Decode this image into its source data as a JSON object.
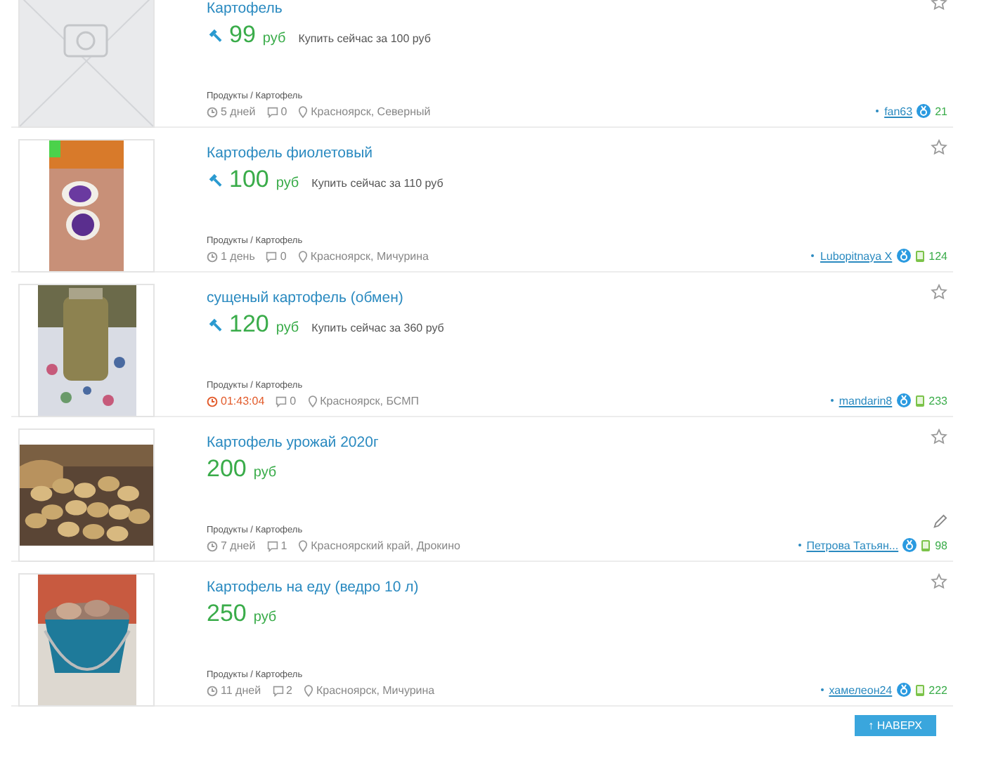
{
  "listings": [
    {
      "title": "Картофель",
      "image": {
        "kind": "placeholder"
      },
      "auction": true,
      "price": "99",
      "currency": "руб",
      "buy_now": "Купить сейчас за 100 руб",
      "category": "Продукты / Картофель",
      "age": "5 дней",
      "urgent": false,
      "comments": "0",
      "location": "Красноярск, Северный",
      "seller": "fan63",
      "verified": true,
      "phone": false,
      "rating": "21",
      "favorite": false,
      "pencil": false
    },
    {
      "title": "Картофель фиолетовый",
      "auction": true,
      "price": "100",
      "currency": "руб",
      "buy_now": "Купить сейчас за 110 руб",
      "category": "Продукты / Картофель",
      "age": "1 день",
      "urgent": false,
      "comments": "0",
      "location": "Красноярск, Мичурина",
      "seller": "Lubopitnaya X",
      "verified": true,
      "phone": true,
      "rating": "124",
      "favorite": false,
      "pencil": false
    },
    {
      "title": "сущеный картофель (обмен)",
      "auction": true,
      "price": "120",
      "currency": "руб",
      "buy_now": "Купить сейчас за 360 руб",
      "category": "Продукты / Картофель",
      "age": "01:43:04",
      "urgent": true,
      "comments": "0",
      "location": "Красноярск, БСМП",
      "seller": "mandarin8",
      "verified": true,
      "phone": true,
      "rating": "233",
      "favorite": false,
      "pencil": false
    },
    {
      "title": "Картофель урожай 2020г",
      "auction": false,
      "price": "200",
      "currency": "руб",
      "category": "Продукты / Картофель",
      "age": "7 дней",
      "urgent": false,
      "comments": "1",
      "location": "Красноярский край, Дрокино",
      "seller": "Петрова Татьян...",
      "verified": true,
      "phone": true,
      "rating": "98",
      "favorite": false,
      "pencil": true
    },
    {
      "title": "Картофель на еду (ведро 10 л)",
      "auction": false,
      "price": "250",
      "currency": "руб",
      "category": "Продукты / Картофель",
      "age": "11 дней",
      "urgent": false,
      "comments": "2",
      "location": "Красноярск, Мичурина",
      "seller": "хамелеон24",
      "verified": true,
      "phone": true,
      "rating": "222",
      "favorite": false,
      "pencil": false
    }
  ],
  "up_button": "↑ НАВЕРХ"
}
